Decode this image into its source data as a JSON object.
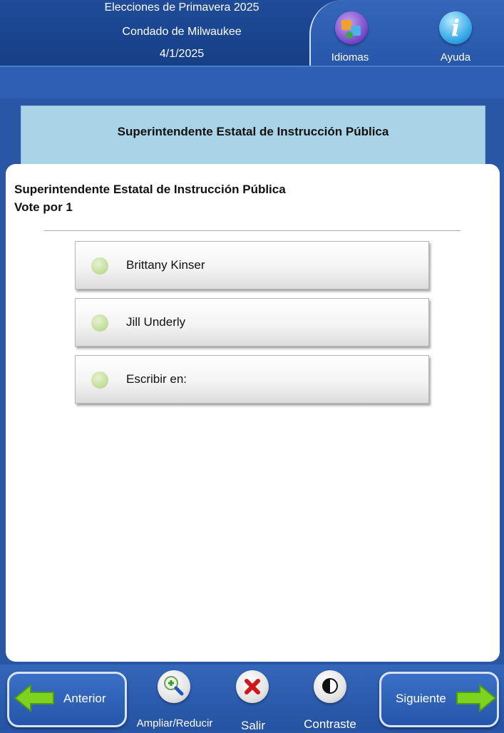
{
  "header": {
    "election": "Elecciones de Primavera 2025",
    "county": "Condado de Milwaukee",
    "date": "4/1/2025",
    "languages_label": "Idiomas",
    "help_label": "Ayuda",
    "help_glyph": "i"
  },
  "banner": {
    "title": "Superintendente Estatal de Instrucción Pública"
  },
  "contest": {
    "title": "Superintendente Estatal de Instrucción Pública",
    "vote_for": "Vote por 1",
    "options": [
      {
        "label": "Brittany Kinser",
        "selected": false
      },
      {
        "label": "Jill Underly",
        "selected": false
      },
      {
        "label": "Escribir en:",
        "selected": false
      }
    ]
  },
  "footer": {
    "previous_label": "Anterior",
    "zoom_label": "Ampliar/Reducir",
    "exit_label": "Salir",
    "contrast_label": "Contraste",
    "next_label": "Siguiente"
  },
  "icons": {
    "languages": "languages-icon",
    "help": "info-icon",
    "zoom": "magnifier-plus-icon",
    "exit": "x-icon",
    "contrast": "contrast-icon",
    "previous": "arrow-left-icon",
    "next": "arrow-right-icon"
  },
  "colors": {
    "background": "#2a56a6",
    "banner": "#a9d4e8",
    "panel": "#ffffff",
    "bubble": "#bfdc97",
    "arrow_green": "#7ed321",
    "exit_red": "#d0181a"
  }
}
